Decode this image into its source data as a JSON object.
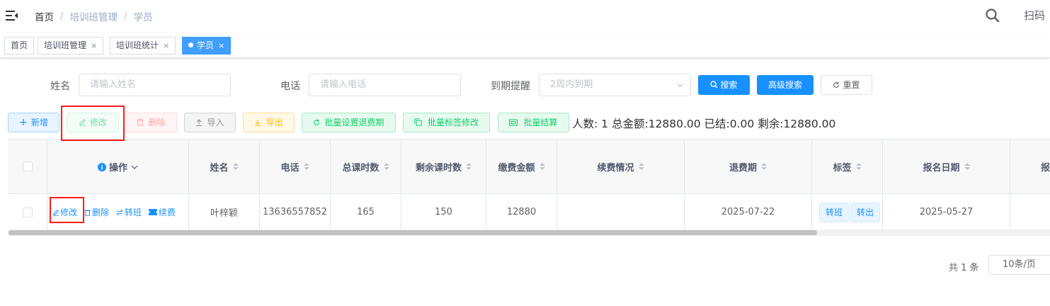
{
  "breadcrumb": [
    "首页",
    "培训班管理",
    "学员"
  ],
  "header": {
    "scan_label": "扫码"
  },
  "tags": [
    {
      "label": "首页"
    },
    {
      "label": "培训班管理",
      "close": "×"
    },
    {
      "label": "培训班统计",
      "close": "×"
    },
    {
      "label": "学员",
      "close": "×",
      "active": true
    }
  ],
  "search": {
    "name_label": "姓名",
    "name_placeholder": "请输入姓名",
    "phone_label": "电话",
    "phone_placeholder": "请输入电话",
    "expire_label": "到期提醒",
    "expire_placeholder": "2周内到期",
    "search_btn": "搜索",
    "advanced_btn": "高级搜索",
    "reset_btn": "重置"
  },
  "toolbar": {
    "add": "新增",
    "edit": "修改",
    "delete": "删除",
    "import": "导入",
    "export": "导出",
    "batch_refund": "批量设置退费期",
    "batch_tag": "批量标签修改",
    "batch_settle": "批量结算",
    "summary": "人数: 1 总金额:12880.00 已结:0.00 剩余:12880.00"
  },
  "table": {
    "headers": {
      "op": "操作",
      "name": "姓名",
      "phone": "电话",
      "total_hours": "总课时数",
      "remain_hours": "剩余课时数",
      "fee": "缴费金额",
      "renew": "续费情况",
      "refund_date": "退费期",
      "tag": "标签",
      "signup_date": "报名日期",
      "next": "报"
    },
    "row": {
      "ops": [
        "修改",
        "删除",
        "转班",
        "续费"
      ],
      "name": "叶梓颖",
      "phone": "13636557852",
      "total_hours": "165",
      "remain_hours": "150",
      "fee": "12880",
      "renew": "",
      "refund_date": "2025-07-22",
      "tags": [
        "转班",
        "转出"
      ],
      "signup_date": "2025-05-27"
    }
  },
  "pagination": {
    "total": "共 1 条",
    "page_size": "10条/页"
  },
  "colors": {
    "primary": "#1890ff",
    "tag_active": "#409eff",
    "highlight": "#ff1a1a"
  }
}
